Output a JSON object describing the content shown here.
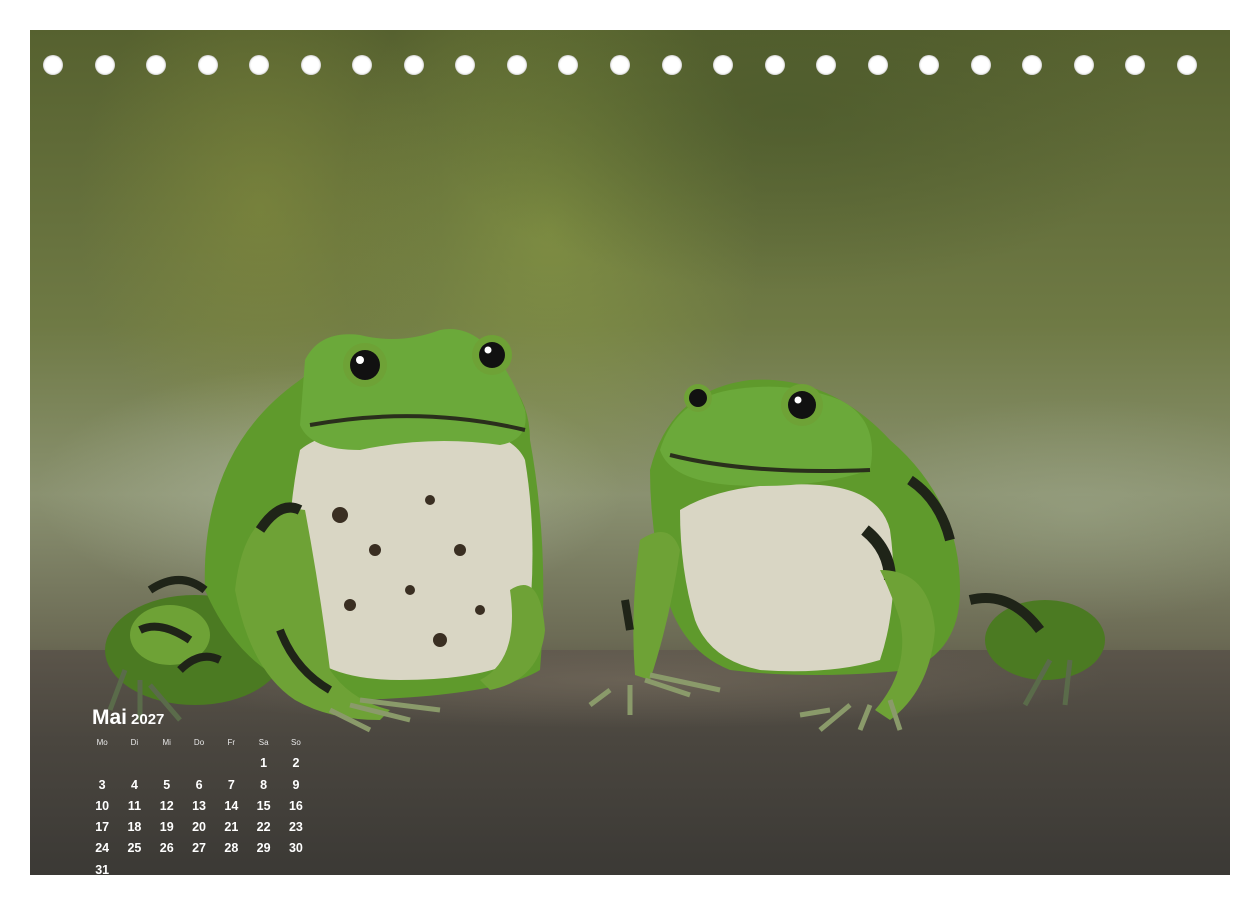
{
  "calendar": {
    "month": "Mai",
    "year": "2027",
    "weekdays": [
      "Mo",
      "Di",
      "Mi",
      "Do",
      "Fr",
      "Sa",
      "So"
    ],
    "start_weekday_index": 5,
    "days": [
      "1",
      "2",
      "3",
      "4",
      "5",
      "6",
      "7",
      "8",
      "9",
      "10",
      "11",
      "12",
      "13",
      "14",
      "15",
      "16",
      "17",
      "18",
      "19",
      "20",
      "21",
      "22",
      "23",
      "24",
      "25",
      "26",
      "27",
      "28",
      "29",
      "30",
      "31"
    ]
  },
  "binding_holes": 23,
  "photo": {
    "subject_icons": [
      "frog-left-icon",
      "frog-right-icon"
    ],
    "colors": {
      "frog_green": "#5f9a2c",
      "belly": "#d8d6c6",
      "spots": "#1f2418"
    }
  }
}
